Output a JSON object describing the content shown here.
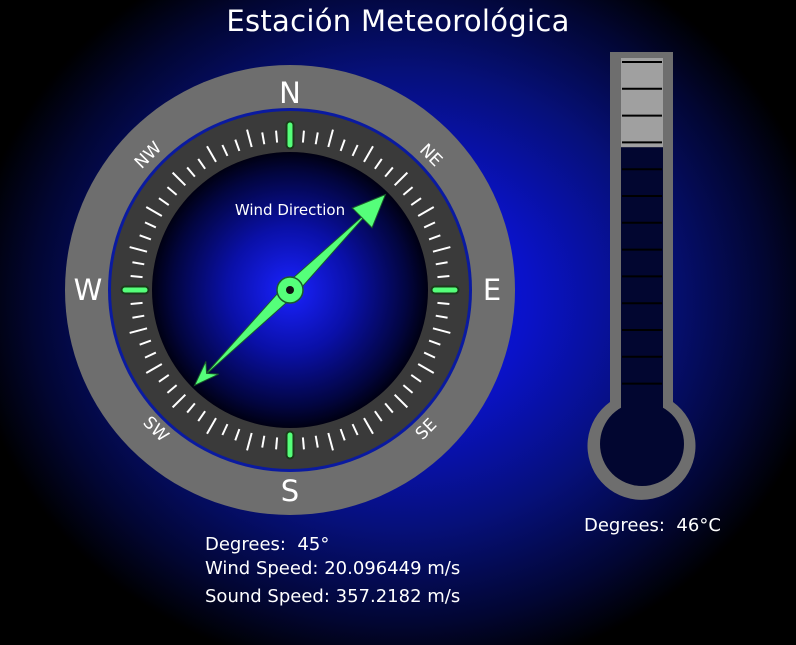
{
  "title": "Estación Meteorológica",
  "compass": {
    "label": "Wind Direction",
    "cardinals": {
      "n": "N",
      "s": "S",
      "e": "E",
      "w": "W"
    },
    "intercardinals": {
      "ne": "NE",
      "nw": "NW",
      "se": "SE",
      "sw": "SW"
    },
    "wind_direction_degrees": 45,
    "needle_color": "#55ff7a",
    "ring_color": "#6e6e6e"
  },
  "wind_info": {
    "degrees_label": "Degrees:",
    "degrees_value": "45°",
    "wind_speed_label": "Wind Speed:",
    "wind_speed_value": "20.096449 m/s",
    "sound_speed_label": "Sound Speed:",
    "sound_speed_value": "357.2182 m/s"
  },
  "thermometer": {
    "degrees_label": "Degrees:",
    "degrees_value": "46°C",
    "fill_fraction": 0.75
  }
}
